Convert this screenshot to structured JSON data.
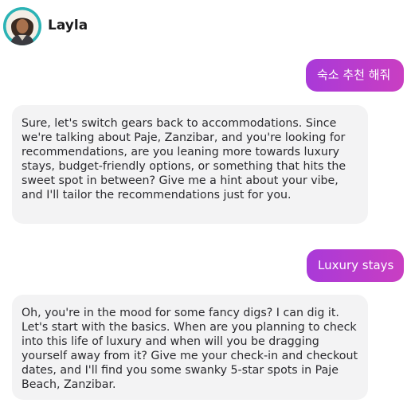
{
  "header": {
    "contact_name": "Layla",
    "avatar_icon": "person-avatar-icon",
    "avatar_ring_color": "#2bb3b5"
  },
  "messages": [
    {
      "sender": "user",
      "text": "숙소 추천 해줘"
    },
    {
      "sender": "bot",
      "text": "Sure, let's switch gears back to accommodations. Since we're talking about Paje, Zanzibar, and you're looking for recommendations, are you leaning more towards luxury stays, budget-friendly options, or something that hits the sweet spot in between? Give me a hint about your vibe, and I'll tailor the recommendations just for you."
    },
    {
      "sender": "user",
      "text": "Luxury stays"
    },
    {
      "sender": "bot",
      "text": "Oh, you're in the mood for some fancy digs? I can dig it. Let's start with the basics. When are you planning to check into this life of luxury and when will you be dragging yourself away from it? Give me your check-in and checkout dates, and I'll find you some swanky 5-star spots in Paje Beach, Zanzibar."
    }
  ],
  "colors": {
    "user_bubble_start": "#a93ad8",
    "user_bubble_end": "#c93ec2",
    "bot_bubble_bg": "#f3f3f4",
    "text": "#1c1c1e"
  }
}
